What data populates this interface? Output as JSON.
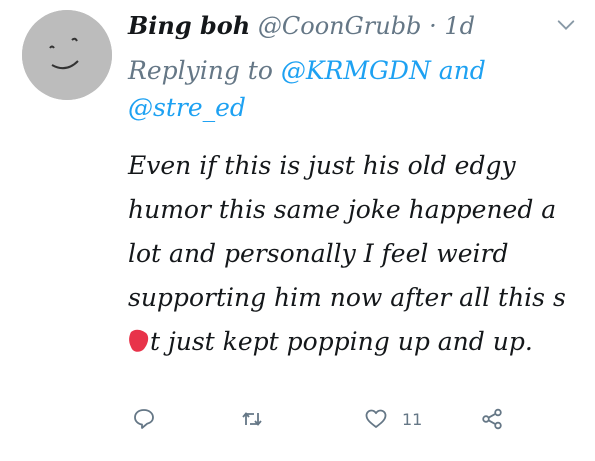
{
  "tweet": {
    "display_name": "Bing boh",
    "handle": "@CoonGrubb",
    "separator": "·",
    "time": "1d",
    "reply_prefix": "Replying to",
    "mention_1": "@KRMGDN",
    "reply_and": "and",
    "mention_2": "@stre_ed",
    "body_part_1": "Even if this is just his old edgy humor this same joke happened a lot and personally I feel weird supporting him now after all this s",
    "body_part_2": "t just kept popping up and up.",
    "like_count": "11"
  },
  "icons": {
    "reply": "reply-icon",
    "retweet": "retweet-icon",
    "like": "heart-icon",
    "share": "share-icon",
    "caret": "chevron-down-icon"
  },
  "colors": {
    "muted": "#657786",
    "link": "#1da1f2",
    "censor": "#e8334a"
  }
}
